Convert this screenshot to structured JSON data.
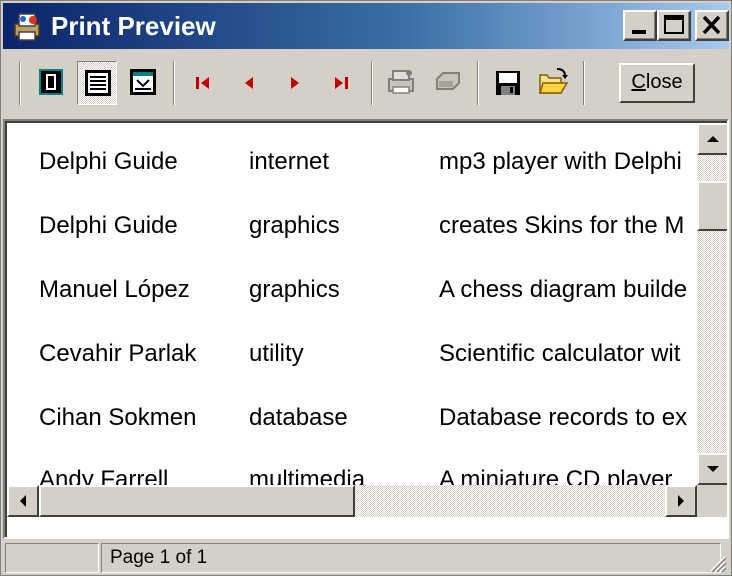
{
  "window": {
    "title": "Print Preview",
    "icon": "printer-preview-icon"
  },
  "toolbar": {
    "buttons": [
      {
        "name": "one-page",
        "icon": "single-page-icon"
      },
      {
        "name": "page-width",
        "icon": "page-width-icon",
        "pressed": true
      },
      {
        "name": "zoom",
        "icon": "zoom-page-icon"
      },
      {
        "name": "first-page",
        "icon": "first-page-icon"
      },
      {
        "name": "prior-page",
        "icon": "prior-page-icon"
      },
      {
        "name": "next-page",
        "icon": "next-page-icon"
      },
      {
        "name": "last-page",
        "icon": "last-page-icon"
      },
      {
        "name": "printer-setup",
        "icon": "printer-setup-icon",
        "disabled": true
      },
      {
        "name": "print",
        "icon": "print-icon",
        "disabled": true
      },
      {
        "name": "save",
        "icon": "floppy-save-icon"
      },
      {
        "name": "open",
        "icon": "open-folder-icon"
      }
    ],
    "close_label_mnemonic": "C",
    "close_label_rest": "lose"
  },
  "report": {
    "rows": [
      {
        "author": "Delphi Guide",
        "category": "internet",
        "description": "mp3 player with Delphi"
      },
      {
        "author": "Delphi Guide",
        "category": "graphics",
        "description": "creates Skins for the M"
      },
      {
        "author": "Manuel López",
        "category": "graphics",
        "description": "A chess diagram builde"
      },
      {
        "author": "Cevahir Parlak",
        "category": "utility",
        "description": "Scientific calculator wit"
      },
      {
        "author": "Cihan Sokmen",
        "category": "database",
        "description": "Database records to ex"
      },
      {
        "author": "Andy Farrell",
        "category": "multimedia",
        "description": "A miniature CD player"
      }
    ]
  },
  "status": {
    "page_label": "Page 1 of 1"
  },
  "colors": {
    "title_gradient_start": "#0a246a",
    "title_gradient_end": "#a6caf0",
    "face": "#d4d0c8",
    "nav_arrow": "#c00000"
  }
}
